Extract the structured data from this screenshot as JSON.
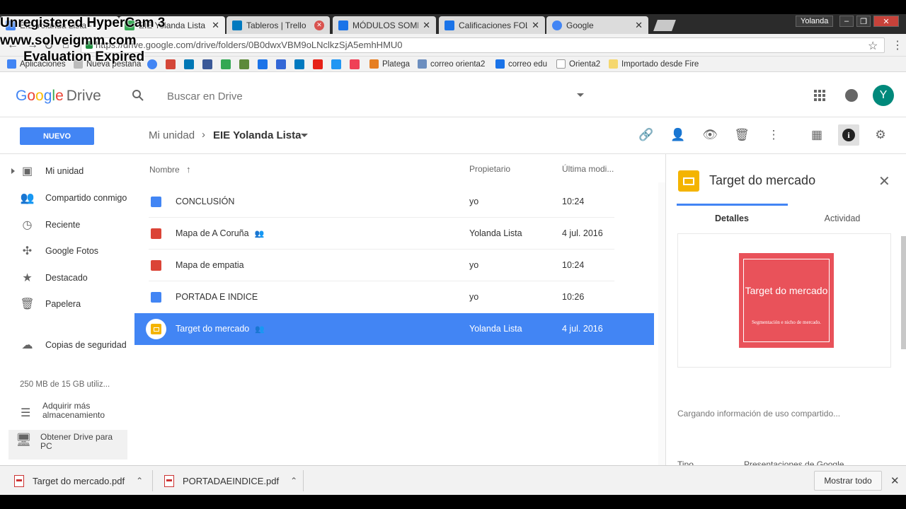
{
  "watermark": {
    "line1": "Unregistered HyperCam 3",
    "line2": "www.solveigmm.com",
    "line3": "Evaluation Expired"
  },
  "window": {
    "user_label": "Yolanda"
  },
  "tabs": [
    {
      "title": "EIE Yolanda Lista -",
      "active": true,
      "favicon_color": "#4285f4"
    },
    {
      "title": "Tableros | Trello",
      "favicon_color": "#0079bf"
    },
    {
      "title": "MÓDULOS SOMES",
      "favicon_color": "#1a73e8"
    },
    {
      "title": "Calificaciones FOL",
      "favicon_color": "#1a73e8"
    },
    {
      "title": "Google",
      "favicon_color": "#4285f4"
    }
  ],
  "address": {
    "url": "https://drive.google.com/drive/folders/0B0dwxVBM9oLNclkzSjA5emhHMU0"
  },
  "bookmarks": [
    {
      "label": "Aplicaciones",
      "color": "#4285f4"
    },
    {
      "label": "Nueva pestaña",
      "color": "#bbbbbb"
    },
    {
      "label": "Platega",
      "color": "#e67e22"
    },
    {
      "label": "correo orienta2",
      "color": "#6c8ebf"
    },
    {
      "label": "correo edu",
      "color": "#1a73e8"
    },
    {
      "label": "Orienta2",
      "color": "#cccccc"
    },
    {
      "label": "Importado desde Fire",
      "color": "#f5d76e"
    }
  ],
  "drive": {
    "logo_google": "Google",
    "logo_drive": "Drive",
    "search_placeholder": "Buscar en Drive",
    "avatar_letter": "Y"
  },
  "toolbar": {
    "new_label": "NUEVO",
    "crumb_root": "Mi unidad",
    "crumb_sep": "›",
    "crumb_current": "EIE Yolanda Lista"
  },
  "sidebar": {
    "items": [
      {
        "label": "Mi unidad"
      },
      {
        "label": "Compartido conmigo"
      },
      {
        "label": "Reciente"
      },
      {
        "label": "Google Fotos"
      },
      {
        "label": "Destacado"
      },
      {
        "label": "Papelera"
      },
      {
        "label": "Copias de seguridad"
      }
    ],
    "storage": "250 MB de 15 GB utiliz...",
    "buy_storage": "Adquirir más almacenamiento",
    "get_drive_pc": "Obtener Drive para PC"
  },
  "filelist": {
    "columns": {
      "name": "Nombre",
      "owner": "Propietario",
      "modified": "Última modi..."
    },
    "rows": [
      {
        "name": "CONCLUSIÓN",
        "owner": "yo",
        "modified": "10:24",
        "type": "doc",
        "shared": false
      },
      {
        "name": "Mapa de A Coruña",
        "owner": "Yolanda Lista",
        "modified": "4 jul. 2016",
        "type": "map",
        "shared": true
      },
      {
        "name": "Mapa de empatia",
        "owner": "yo",
        "modified": "10:24",
        "type": "map",
        "shared": false
      },
      {
        "name": "PORTADA E INDICE",
        "owner": "yo",
        "modified": "10:26",
        "type": "doc",
        "shared": false
      },
      {
        "name": "Target do mercado",
        "owner": "Yolanda Lista",
        "modified": "4 jul. 2016",
        "type": "slides",
        "shared": true,
        "selected": true
      }
    ]
  },
  "details": {
    "title": "Target do mercado",
    "tab_details": "Detalles",
    "tab_activity": "Actividad",
    "slide_title": "Target do mercado",
    "slide_subtitle": "Segmentación e nicho de mercado.",
    "loading": "Cargando información de uso compartido...",
    "type_label": "Tipo",
    "type_value": "Presentaciones de Google"
  },
  "downloads": {
    "items": [
      {
        "name": "Target do mercado.pdf"
      },
      {
        "name": "PORTADAEINDICE.pdf"
      }
    ],
    "show_all": "Mostrar todo"
  },
  "colors": {
    "accent": "#4285f4",
    "slides_yellow": "#f4b400",
    "doc_blue": "#4285f4",
    "map_red": "#db4437",
    "slide_bg": "#e9525a",
    "avatar": "#00897b"
  }
}
